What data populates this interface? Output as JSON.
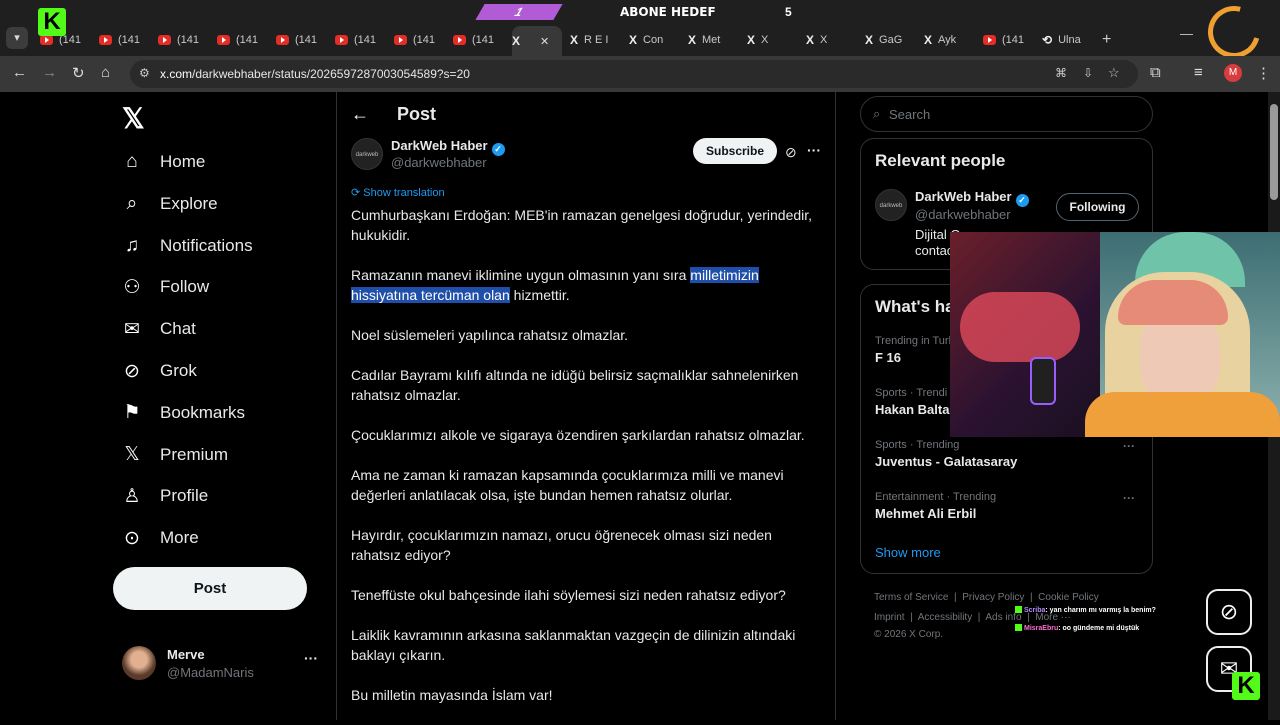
{
  "overlay": {
    "badge": "1",
    "goal_text": "ABONE HEDEF",
    "goal_num": "5"
  },
  "tabs": [
    {
      "kind": "yt",
      "label": "(141"
    },
    {
      "kind": "yt",
      "label": "(141"
    },
    {
      "kind": "yt",
      "label": "(141"
    },
    {
      "kind": "yt",
      "label": "(141"
    },
    {
      "kind": "yt",
      "label": "(141"
    },
    {
      "kind": "yt",
      "label": "(141"
    },
    {
      "kind": "yt",
      "label": "(141"
    },
    {
      "kind": "yt",
      "label": "(141"
    },
    {
      "kind": "x",
      "label": ""
    },
    {
      "kind": "x",
      "label": "R E I"
    },
    {
      "kind": "x",
      "label": "Con"
    },
    {
      "kind": "x",
      "label": "Met"
    },
    {
      "kind": "x",
      "label": "X"
    },
    {
      "kind": "x",
      "label": "X"
    },
    {
      "kind": "x",
      "label": "GaG"
    },
    {
      "kind": "x",
      "label": "Ayk"
    },
    {
      "kind": "yt",
      "label": "(141"
    },
    {
      "kind": "web",
      "label": "Ulna"
    }
  ],
  "address": {
    "host": "x.com",
    "path": "/darkwebhaber/status/2026597287003054589?s=20",
    "profile_initial": "M"
  },
  "nav": {
    "items": [
      {
        "label": "Home",
        "icon": "home-icon"
      },
      {
        "label": "Explore",
        "icon": "search-icon"
      },
      {
        "label": "Notifications",
        "icon": "bell-icon"
      },
      {
        "label": "Follow",
        "icon": "add-person-icon"
      },
      {
        "label": "Chat",
        "icon": "mail-icon"
      },
      {
        "label": "Grok",
        "icon": "grok-icon"
      },
      {
        "label": "Bookmarks",
        "icon": "bookmark-icon"
      },
      {
        "label": "Premium",
        "icon": "x-logo-icon"
      },
      {
        "label": "Profile",
        "icon": "person-icon"
      },
      {
        "label": "More",
        "icon": "more-circle-icon"
      }
    ],
    "post_label": "Post",
    "account": {
      "name": "Merve",
      "handle": "@MadamNaris"
    }
  },
  "post": {
    "header_title": "Post",
    "author": {
      "name": "DarkWeb Haber",
      "handle": "@darkwebhaber",
      "avatar_text": "darkweb"
    },
    "subscribe_label": "Subscribe",
    "translation_label": "Show translation",
    "paragraphs": [
      {
        "text": "Cumhurbaşkanı Erdoğan: MEB'in ramazan genelgesi doğrudur, yerindedir, hukukidir."
      },
      {
        "pre": "Ramazanın manevi iklimine uygun olmasının yanı sıra ",
        "hl": "milletimizin hissiyatına tercüman olan",
        "post": " hizmettir."
      },
      {
        "text": "Noel süslemeleri yapılınca rahatsız olmazlar."
      },
      {
        "text": "Cadılar Bayramı kılıfı altında ne idüğü belirsiz saçmalıklar sahnelenirken rahatsız olmazlar."
      },
      {
        "text": "Çocuklarımızı alkole ve sigaraya özendiren şarkılardan rahatsız olmazlar."
      },
      {
        "text": "Ama ne zaman ki ramazan kapsamında çocuklarımıza milli ve manevi değerleri anlatılacak olsa, işte bundan hemen rahatsız olurlar."
      },
      {
        "text": "Hayırdır, çocuklarımızın namazı, orucu öğrenecek olması sizi neden rahatsız ediyor?"
      },
      {
        "text": "Teneffüste okul bahçesinde ilahi söylemesi sizi neden rahatsız ediyor?"
      },
      {
        "text": "Laiklik kavramının arkasına saklanmaktan vazgeçin de dilinizin altındaki baklayı çıkarın."
      },
      {
        "text": "Bu milletin mayasında İslam var!"
      }
    ]
  },
  "sidebar": {
    "search_placeholder": "Search",
    "relevant": {
      "title": "Relevant people",
      "name": "DarkWeb Haber",
      "handle": "@darkwebhaber",
      "bio1": "Dijital Gaz",
      "bio2": "contac",
      "follow_label": "Following"
    },
    "happening": {
      "title": "What's ha",
      "trends": [
        {
          "meta": "Trending in Turk",
          "title": "F 16"
        },
        {
          "meta": "Sports · Trendi",
          "title": "Hakan Balta"
        },
        {
          "meta": "Sports · Trending",
          "title": "Juventus - Galatasaray"
        },
        {
          "meta": "Entertainment · Trending",
          "title": "Mehmet Ali Erbil"
        }
      ],
      "show_more": "Show more"
    },
    "footer": {
      "row1": [
        "Terms of Service",
        "Privacy Policy",
        "Cookie Policy"
      ],
      "row2": [
        "Imprint",
        "Accessibility",
        "Ads info",
        "More ···"
      ],
      "copyright": "© 2026 X Corp."
    }
  },
  "chat": [
    {
      "user": "Scriba",
      "msg": ": yan charım mı varmış la benim?"
    },
    {
      "user": "MisraEbru",
      "msg": ": oo gündeme mi düştük"
    }
  ],
  "colors": {
    "accent": "#1d9bf0",
    "kick": "#53fc18",
    "highlight": "#1f4fa8"
  }
}
